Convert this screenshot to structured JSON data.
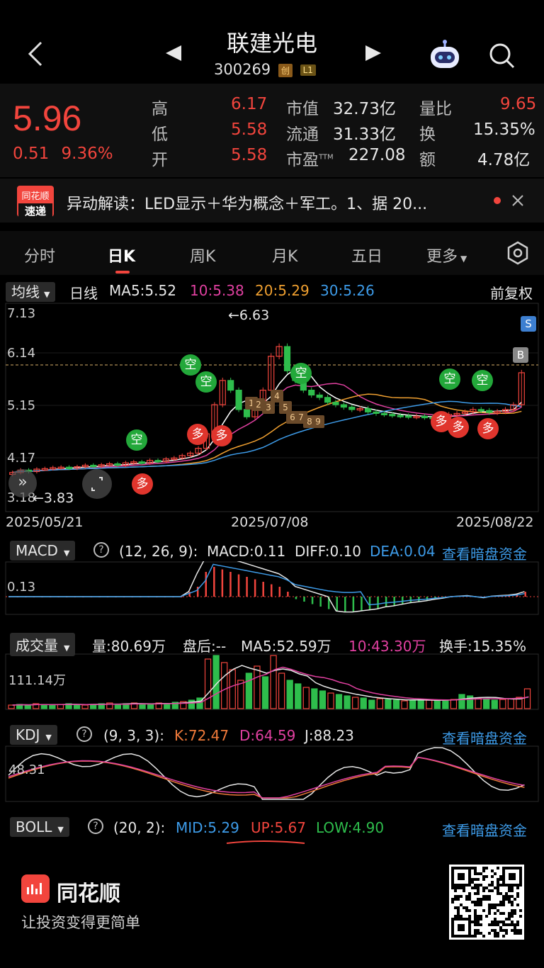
{
  "header": {
    "stock_name": "联建光电",
    "stock_code": "300269",
    "badge_chuang": "创",
    "badge_level": "L1"
  },
  "quote": {
    "price": "5.96",
    "change": "0.51",
    "change_pct": "9.36%",
    "high_label": "高",
    "high": "6.17",
    "low_label": "低",
    "low": "5.58",
    "open_label": "开",
    "open": "5.58",
    "mktcap_label": "市值",
    "mktcap": "32.73亿",
    "float_label": "流通",
    "float": "31.33亿",
    "pe_label": "市盈",
    "pe_sup": "TTM",
    "pe": "227.08",
    "vr_label": "量比",
    "vr": "9.65",
    "turnover_label": "换",
    "turnover": "15.35%",
    "amount_label": "额",
    "amount": "4.78亿"
  },
  "news": {
    "logo_top": "同花顺",
    "logo_bottom": "速递",
    "text": "异动解读：LED显示＋华为概念＋军工。1、据 20..."
  },
  "tabs": [
    "分时",
    "日K",
    "周K",
    "月K",
    "五日",
    "更多"
  ],
  "active_tab": "日K",
  "ma_bar": {
    "chip": "均线",
    "period": "日线",
    "ma5": "MA5:5.52",
    "ma10": "10:5.38",
    "ma20": "20:5.29",
    "ma30": "30:5.26",
    "adjust": "前复权"
  },
  "kline": {
    "y_labels": [
      "7.13",
      "6.14",
      "5.15",
      "4.17",
      "3.18"
    ],
    "max_mark": "←6.63",
    "min_mark": "←3.83",
    "dates": [
      "2025/05/21",
      "2025/07/08",
      "2025/08/22"
    ],
    "signal_short": "空",
    "signal_long": "多",
    "signal_s": "S",
    "signal_b": "B",
    "nums": [
      "1",
      "2",
      "3",
      "4",
      "5",
      "6",
      "7",
      "8",
      "9"
    ]
  },
  "macd": {
    "chip": "MACD",
    "params": "(12, 26, 9):",
    "macd": "MACD:0.11",
    "diff": "DIFF:0.10",
    "dea": "DEA:0.04",
    "link": "查看暗盘资金",
    "axis": "0.13"
  },
  "volume": {
    "chip": "成交量",
    "vol": "量:80.69万",
    "after": "盘后:--",
    "ma5": "MA5:52.59万",
    "ma10": "10:43.30万",
    "turnover": "换手:15.35%",
    "axis": "111.14万"
  },
  "kdj": {
    "chip": "KDJ",
    "params": "(9, 3, 3):",
    "k": "K:72.47",
    "d": "D:64.59",
    "j": "J:88.23",
    "link": "查看暗盘资金",
    "axis": "48.31"
  },
  "boll": {
    "chip": "BOLL",
    "params": "(20, 2):",
    "mid": "MID:5.29",
    "up": "UP:5.67",
    "low": "LOW:4.90",
    "link": "查看暗盘资金"
  },
  "footer": {
    "brand": "同花顺",
    "slogan": "让投资变得更简单"
  },
  "colors": {
    "up": "#f2453d",
    "down": "#2ebd4c",
    "ma5": "#ffffff",
    "ma10": "#e040a0",
    "ma20": "#f0a030",
    "ma30": "#3d9be8"
  }
}
